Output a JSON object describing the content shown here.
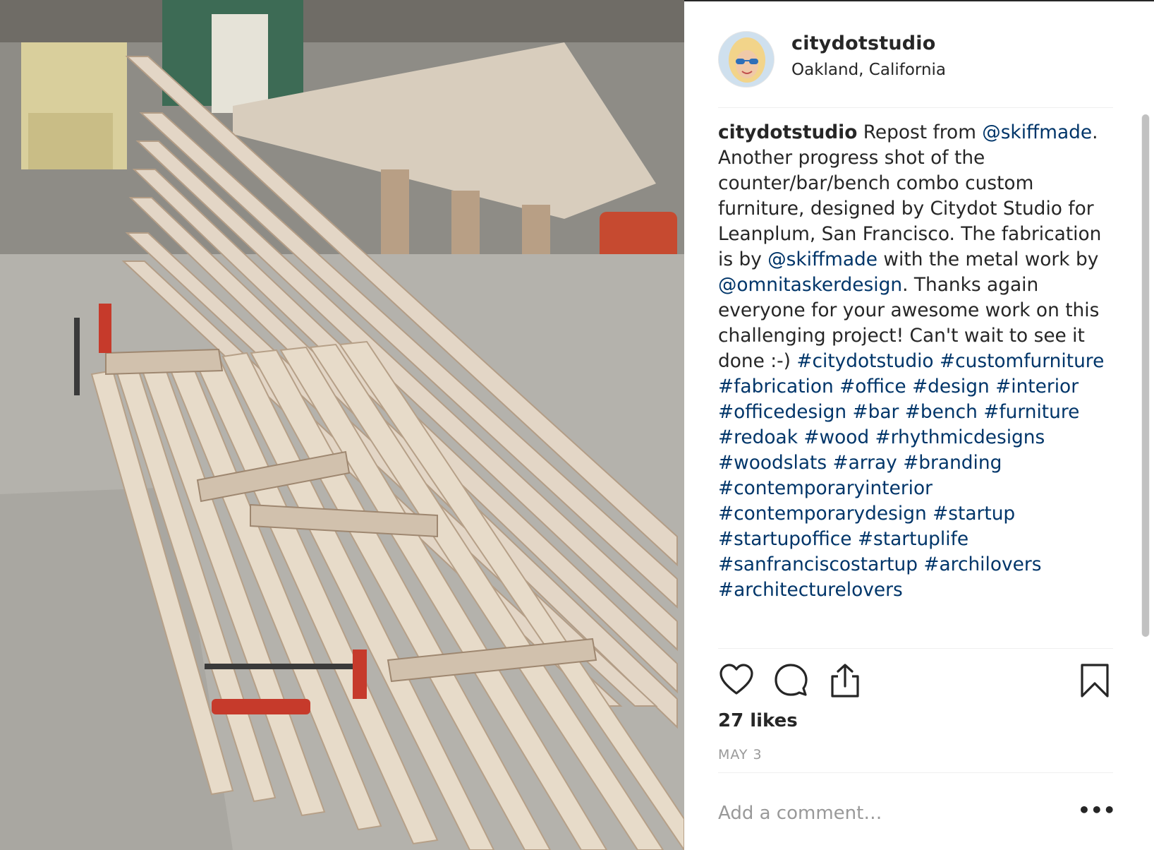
{
  "photo": {
    "alt_icon": "wood-slat-bench-photo"
  },
  "post": {
    "username": "citydotstudio",
    "location": "Oakland, California"
  },
  "caption": {
    "username": "citydotstudio",
    "text_1": " Repost from ",
    "mention_1": "@skiffmade",
    "text_2": ". Another progress shot of the counter/bar/bench combo custom furniture, designed by Citydot Studio for Leanplum, San Francisco. The fabrication is by ",
    "mention_2": "@skiffmade",
    "text_3": " with the metal work by ",
    "mention_3": "@omnitaskerdesign",
    "text_4": ". Thanks again everyone for your awesome work on this challenging project! Can't wait to see it done :-)",
    "hashtags": [
      "#citydotstudio",
      "#customfurniture",
      "#fabrication",
      "#office",
      "#design",
      "#interior",
      "#officedesign",
      "#bar",
      "#bench",
      "#furniture",
      "#redoak",
      "#wood",
      "#rhythmicdesigns",
      "#woodslats",
      "#array",
      "#branding",
      "#contemporaryinterior",
      "#contemporarydesign",
      "#startup",
      "#startupoffice",
      "#startuplife",
      "#sanfranciscostartup",
      "#archilovers",
      "#architecturelovers"
    ]
  },
  "actions": {
    "like_icon": "heart-icon",
    "comment_icon": "comment-bubble-icon",
    "share_icon": "share-upload-icon",
    "save_icon": "bookmark-icon"
  },
  "stats": {
    "likes": "27 likes",
    "date": "MAY 3"
  },
  "comment": {
    "placeholder": "Add a comment…",
    "more": "•••"
  },
  "colors": {
    "link": "#003569",
    "text": "#262626",
    "muted": "#999999"
  }
}
